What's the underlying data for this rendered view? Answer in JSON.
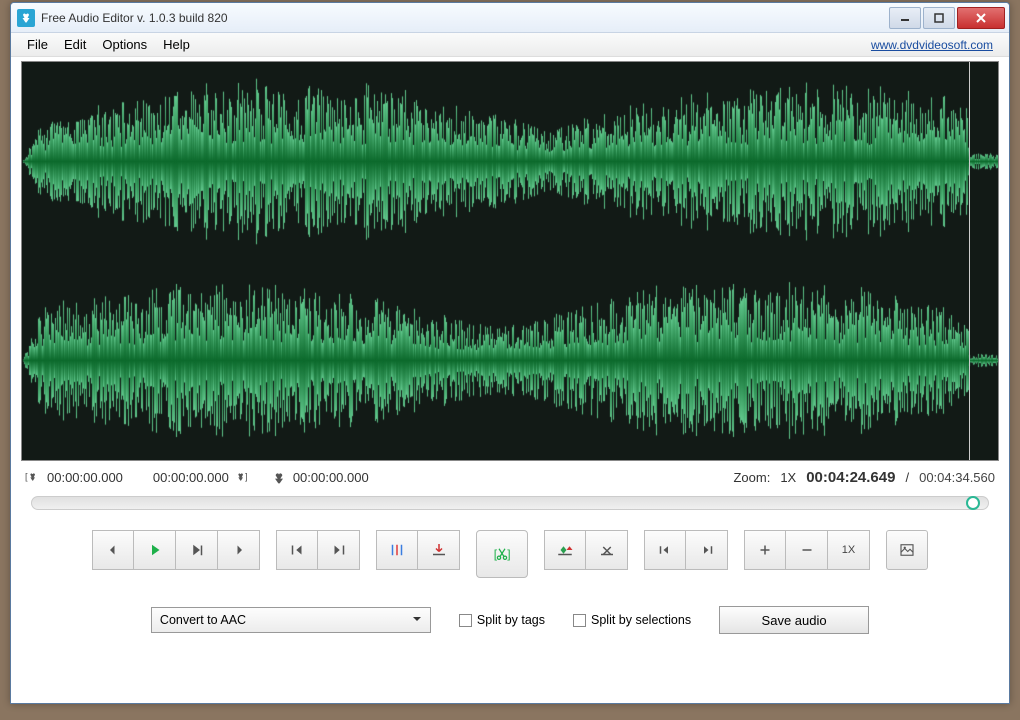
{
  "window": {
    "title": "Free Audio Editor v. 1.0.3 build 820"
  },
  "menubar": {
    "items": [
      "File",
      "Edit",
      "Options",
      "Help"
    ],
    "link": "www.dvdvideosoft.com"
  },
  "selection": {
    "start": "00:00:00.000",
    "end": "00:00:00.000",
    "duration": "00:00:00.000"
  },
  "zoom_label": "Zoom:",
  "zoom_value": "1X",
  "position": "00:04:24.649",
  "separator": "/",
  "total": "00:04:34.560",
  "toolbar": {
    "zoom_reset_label": "1X"
  },
  "bottom": {
    "convert_selected": "Convert to AAC",
    "split_tags": "Split by tags",
    "split_selections": "Split by selections",
    "save": "Save audio"
  },
  "colors": {
    "waveform_bg": "#121a16",
    "waveform_light": "#62c98e",
    "waveform_dark": "#0c6a2c",
    "play_green": "#1eb04a"
  }
}
